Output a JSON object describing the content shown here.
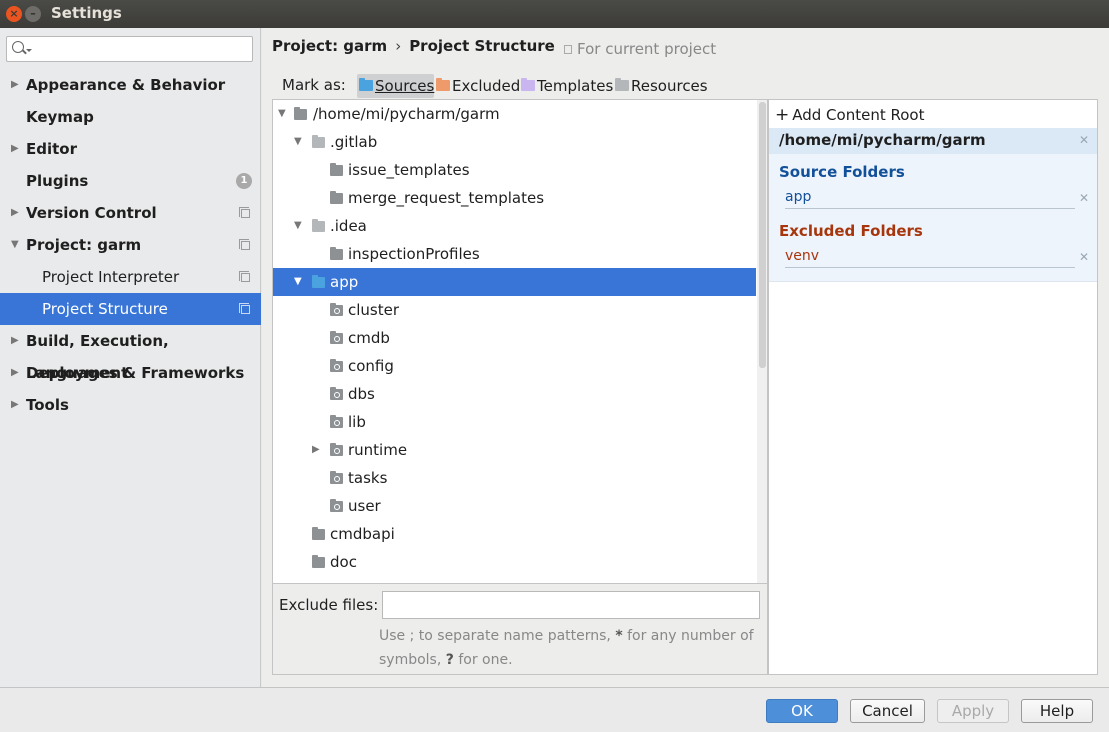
{
  "window": {
    "title": "Settings"
  },
  "search": {
    "placeholder": "",
    "value": ""
  },
  "sidebar": {
    "items": [
      {
        "label": "Appearance & Behavior"
      },
      {
        "label": "Keymap"
      },
      {
        "label": "Editor"
      },
      {
        "label": "Plugins",
        "badge": "1"
      },
      {
        "label": "Version Control"
      },
      {
        "label": "Project: garm"
      },
      {
        "label": "Project Interpreter"
      },
      {
        "label": "Project Structure"
      },
      {
        "label": "Build, Execution, Deployment"
      },
      {
        "label": "Languages & Frameworks"
      },
      {
        "label": "Tools"
      }
    ]
  },
  "breadcrumb": {
    "part1": "Project: garm",
    "separator": "›",
    "part2": "Project Structure"
  },
  "for_current_project": "For current project",
  "mark_as": {
    "label": "Mark as:",
    "sources": "Sources",
    "excluded": "Excluded",
    "templates": "Templates",
    "resources": "Resources"
  },
  "tree": {
    "root": "/home/mi/pycharm/garm",
    "gitlab": ".gitlab",
    "issue_templates": "issue_templates",
    "merge_request_templates": "merge_request_templates",
    "idea": ".idea",
    "inspection_profiles": "inspectionProfiles",
    "app": "app",
    "cluster": "cluster",
    "cmdb": "cmdb",
    "config": "config",
    "dbs": "dbs",
    "lib": "lib",
    "runtime": "runtime",
    "tasks": "tasks",
    "user": "user",
    "cmdbapi": "cmdbapi",
    "doc": "doc"
  },
  "exclude": {
    "label": "Exclude files:",
    "value": "",
    "hint_part1": "Use ; to separate name patterns, ",
    "hint_star": "*",
    "hint_part2": " for any number of symbols, ",
    "hint_q": "?",
    "hint_part3": " for one."
  },
  "roots": {
    "add_label": "Add Content Root",
    "path": "/home/mi/pycharm/garm",
    "source_folders_label": "Source Folders",
    "source_folders": [
      "app"
    ],
    "excluded_folders_label": "Excluded Folders",
    "excluded_folders": [
      "venv"
    ]
  },
  "buttons": {
    "ok": "OK",
    "cancel": "Cancel",
    "apply": "Apply",
    "help": "Help"
  },
  "colors": {
    "selection": "#3875d7",
    "source": "#12509a",
    "excluded": "#a8360c",
    "ok_button": "#4e8fd9"
  }
}
